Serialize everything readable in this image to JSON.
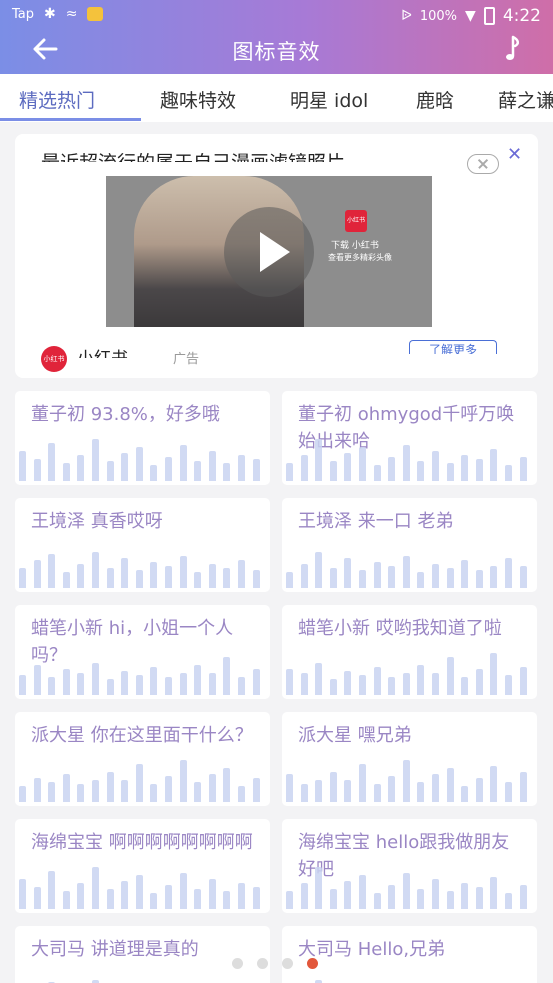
{
  "status_bar": {
    "carrier": "Tap",
    "battery": "100%",
    "time": "4:22"
  },
  "header": {
    "title": "图标音效"
  },
  "tabs": [
    {
      "label": "精选热门",
      "active": true
    },
    {
      "label": "趣味特效",
      "active": false
    },
    {
      "label": "明星 idol",
      "active": false
    },
    {
      "label": "鹿晗",
      "active": false
    },
    {
      "label": "薛之谦",
      "active": false
    }
  ],
  "ad": {
    "headline": "最近超流行的属于自己漫画滤镜照片",
    "brand": "小红书",
    "ad_label": "广告",
    "cta": "了解更多",
    "video_caption_line1": "下载 小红书",
    "video_caption_line2": "查看更多精彩头像",
    "logo_text": "小红书"
  },
  "sounds": [
    {
      "label": "董子初 93.8%，好多哦"
    },
    {
      "label": "董子初 ohmygod千呼万唤始出来哈"
    },
    {
      "label": "王境泽 真香哎呀"
    },
    {
      "label": "王境泽 来一口 老弟"
    },
    {
      "label": "蜡笔小新 hi，小姐一个人吗？"
    },
    {
      "label": "蜡笔小新 哎哟我知道了啦"
    },
    {
      "label": "派大星 你在这里面干什么？"
    },
    {
      "label": "派大星 嘿兄弟"
    },
    {
      "label": "海绵宝宝 啊啊啊啊啊啊啊啊"
    },
    {
      "label": "海绵宝宝 hello跟我做朋友好吧"
    },
    {
      "label": "大司马 讲道理是真的"
    },
    {
      "label": "大司马 Hello,兄弟"
    }
  ],
  "pager": {
    "count": 4,
    "active_index": 3
  },
  "colors": {
    "accent": "#7b8ee6",
    "label": "#9a86c4",
    "wave": "#c9d4f1",
    "pager_active": "#e2573b"
  }
}
